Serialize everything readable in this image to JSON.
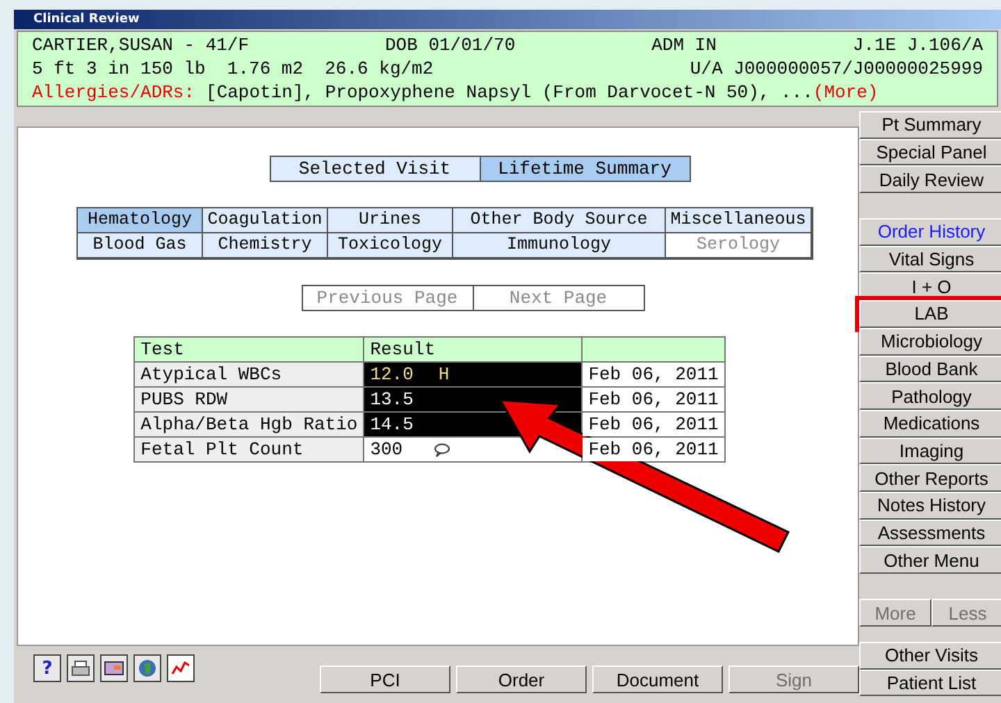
{
  "window": {
    "title": "Clinical Review"
  },
  "patient": {
    "name": "CARTIER,SUSAN - 41/F",
    "dob": "DOB 01/01/70",
    "admission": "ADM IN",
    "location": "J.1E J.106/A",
    "measurements": "5 ft 3 in 150 lb  1.76 m2  26.6 kg/m2",
    "account": "U/A J000000057/J00000025999",
    "allergy_label": "Allergies/ADRs:",
    "allergies": "[Capotin], Propoxyphene Napsyl (From Darvocet-N 50), ...",
    "more_link": "(More)"
  },
  "view_tabs": [
    {
      "label": "Selected Visit",
      "selected": false
    },
    {
      "label": "Lifetime Summary",
      "selected": true
    }
  ],
  "categories": [
    {
      "label": "Hematology",
      "selected": true,
      "disabled": false
    },
    {
      "label": "Coagulation",
      "selected": false,
      "disabled": false
    },
    {
      "label": "Urines",
      "selected": false,
      "disabled": false
    },
    {
      "label": "Other Body Source",
      "selected": false,
      "disabled": false
    },
    {
      "label": "Miscellaneous",
      "selected": false,
      "disabled": false
    },
    {
      "label": "Blood Gas",
      "selected": false,
      "disabled": false
    },
    {
      "label": "Chemistry",
      "selected": false,
      "disabled": false
    },
    {
      "label": "Toxicology",
      "selected": false,
      "disabled": false
    },
    {
      "label": "Immunology",
      "selected": false,
      "disabled": false
    },
    {
      "label": "Serology",
      "selected": false,
      "disabled": true
    }
  ],
  "paging": [
    {
      "label": "Previous Page",
      "disabled": true
    },
    {
      "label": "Next Page",
      "disabled": true
    }
  ],
  "table": {
    "columns": [
      "Test",
      "Result"
    ],
    "rows": [
      {
        "test": "Atypical WBCs",
        "result": "12.0",
        "flag": "H",
        "abnormal": true,
        "highlighted": true,
        "comment": false,
        "date": "Feb 06, 2011"
      },
      {
        "test": "PUBS RDW",
        "result": "13.5",
        "abnormal": false,
        "highlighted": true,
        "comment": false,
        "date": "Feb 06, 2011"
      },
      {
        "test": "Alpha/Beta Hgb Ratio",
        "result": "14.5",
        "abnormal": false,
        "highlighted": true,
        "comment": false,
        "date": "Feb 06, 2011"
      },
      {
        "test": "Fetal Plt Count",
        "result": "300",
        "abnormal": false,
        "highlighted": false,
        "comment": true,
        "date": "Feb 06, 2011"
      }
    ]
  },
  "side_groups": [
    [
      {
        "label": "Pt Summary",
        "active": false,
        "outlined": false
      },
      {
        "label": "Special Panel",
        "active": false,
        "outlined": false
      },
      {
        "label": "Daily Review",
        "active": false,
        "outlined": false
      }
    ],
    [
      {
        "label": "Order History",
        "active": true,
        "outlined": false
      },
      {
        "label": "Vital Signs",
        "active": false,
        "outlined": false
      },
      {
        "label": "I + O",
        "active": false,
        "outlined": false
      },
      {
        "label": "LAB",
        "active": false,
        "outlined": true
      },
      {
        "label": "Microbiology",
        "active": false,
        "outlined": false
      },
      {
        "label": "Blood Bank",
        "active": false,
        "outlined": false
      },
      {
        "label": "Pathology",
        "active": false,
        "outlined": false
      },
      {
        "label": "Medications",
        "active": false,
        "outlined": false
      },
      {
        "label": "Imaging",
        "active": false,
        "outlined": false
      },
      {
        "label": "Other Reports",
        "active": false,
        "outlined": false
      },
      {
        "label": "Notes History",
        "active": false,
        "outlined": false
      },
      {
        "label": "Assessments",
        "active": false,
        "outlined": false
      },
      {
        "label": "Other Menu",
        "active": false,
        "outlined": false
      }
    ]
  ],
  "more_less": [
    {
      "label": "More",
      "disabled": true
    },
    {
      "label": "Less",
      "disabled": true
    }
  ],
  "side_bottom": [
    {
      "label": "Other Visits"
    },
    {
      "label": "Patient List"
    }
  ],
  "toolbar_icons": [
    {
      "kind": "help",
      "label": "?"
    },
    {
      "kind": "print"
    },
    {
      "kind": "card"
    },
    {
      "kind": "globe"
    },
    {
      "kind": "chart"
    }
  ],
  "actions": [
    {
      "label": "PCI",
      "disabled": false
    },
    {
      "label": "Order",
      "disabled": false
    },
    {
      "label": "Document",
      "disabled": false
    },
    {
      "label": "Sign",
      "disabled": true
    }
  ]
}
